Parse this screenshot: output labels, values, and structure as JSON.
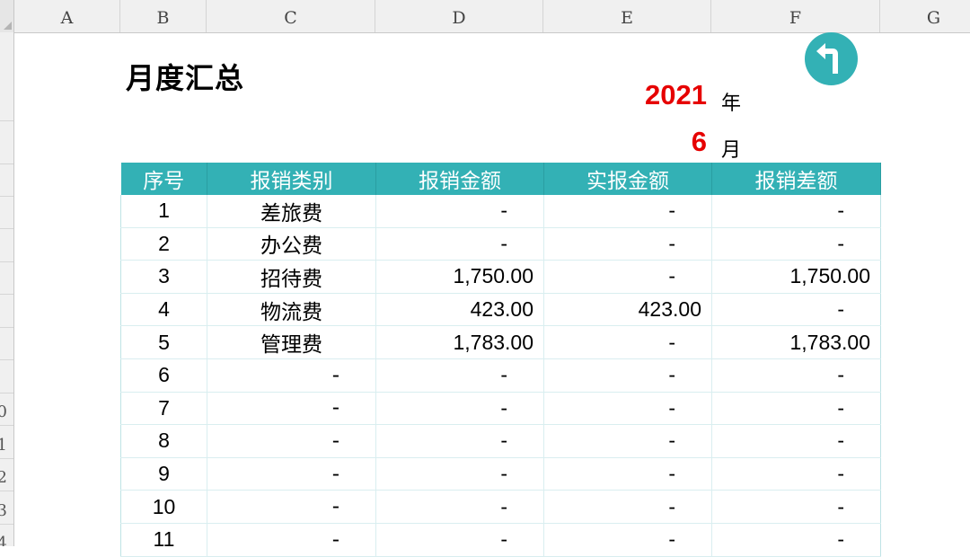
{
  "spreadsheet": {
    "columns": [
      "A",
      "B",
      "C",
      "D",
      "E",
      "F",
      "G"
    ],
    "rows": [
      "0",
      "1",
      "2",
      "3",
      "4"
    ]
  },
  "sheet": {
    "title": "月度汇总",
    "year_value": "2021",
    "year_unit": "年",
    "month_value": "6",
    "month_unit": "月",
    "back_button_icon": "return-arrow-icon",
    "accent_color": "#33b1b5",
    "date_color": "#e60000"
  },
  "table": {
    "headers": [
      "序号",
      "报销类别",
      "报销金额",
      "实报金额",
      "报销差额"
    ],
    "rows": [
      [
        "1",
        "差旅费",
        "-",
        "-",
        "-"
      ],
      [
        "2",
        "办公费",
        "-",
        "-",
        "-"
      ],
      [
        "3",
        "招待费",
        "1,750.00",
        "-",
        "1,750.00"
      ],
      [
        "4",
        "物流费",
        "423.00",
        "423.00",
        "-"
      ],
      [
        "5",
        "管理费",
        "1,783.00",
        "-",
        "1,783.00"
      ],
      [
        "6",
        "-",
        "-",
        "-",
        "-"
      ],
      [
        "7",
        "-",
        "-",
        "-",
        "-"
      ],
      [
        "8",
        "-",
        "-",
        "-",
        "-"
      ],
      [
        "9",
        "-",
        "-",
        "-",
        "-"
      ],
      [
        "10",
        "-",
        "-",
        "-",
        "-"
      ],
      [
        "11",
        "-",
        "-",
        "-",
        "-"
      ]
    ]
  }
}
